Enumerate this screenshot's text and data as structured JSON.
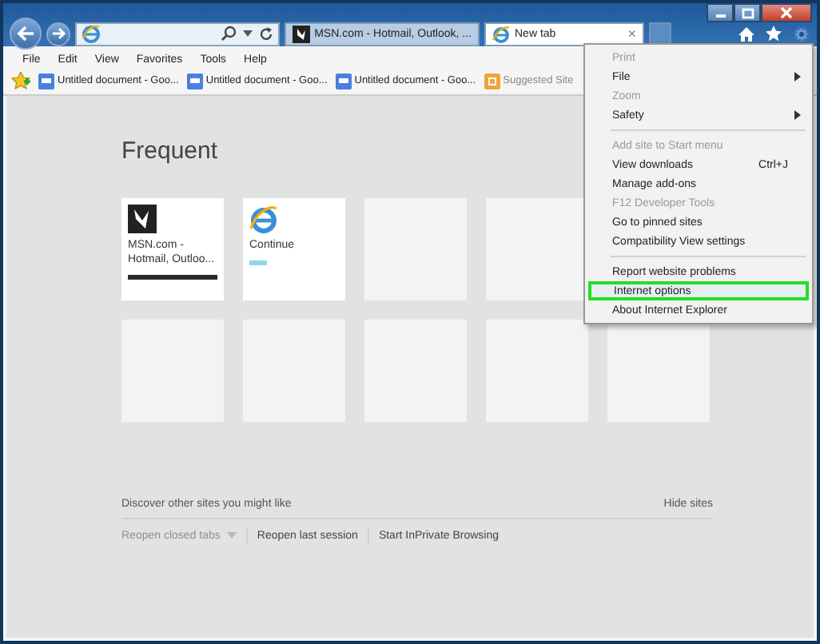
{
  "tabs": [
    {
      "label": "MSN.com - Hotmail, Outlook, ...",
      "kind": "msn",
      "selected": false
    },
    {
      "label": "New tab",
      "kind": "ie",
      "selected": true,
      "close": "×"
    }
  ],
  "menu_bar": [
    "File",
    "Edit",
    "View",
    "Favorites",
    "Tools",
    "Help"
  ],
  "favorites_bar": [
    {
      "label": "Untitled document - Goo...",
      "kind": "doc"
    },
    {
      "label": "Untitled document - Goo...",
      "kind": "doc"
    },
    {
      "label": "Untitled document - Goo...",
      "kind": "doc"
    },
    {
      "label": "Suggested Site",
      "kind": "suggested"
    }
  ],
  "frequent": {
    "title": "Frequent",
    "tile_rows": [
      [
        {
          "kind": "msn",
          "label": "MSN.com - Hotmail, Outloo..."
        },
        {
          "kind": "ie",
          "label": "Continue"
        },
        {
          "kind": "empty"
        },
        {
          "kind": "empty"
        }
      ],
      [
        {
          "kind": "empty"
        },
        {
          "kind": "empty"
        },
        {
          "kind": "empty"
        },
        {
          "kind": "empty"
        },
        {
          "kind": "empty"
        }
      ]
    ]
  },
  "discover": "Discover other sites you might like",
  "hide_sites": "Hide sites",
  "links": [
    {
      "label": "Reopen closed tabs",
      "disabled": true,
      "dropdown": true
    },
    {
      "label": "Reopen last session",
      "disabled": false,
      "dropdown": false
    },
    {
      "label": "Start InPrivate Browsing",
      "disabled": false,
      "dropdown": false
    }
  ],
  "tools_menu": {
    "items": [
      {
        "label": "Print",
        "disabled": true,
        "submenu": false,
        "selected": false
      },
      {
        "label": "File",
        "disabled": false,
        "submenu": true,
        "selected": false
      },
      {
        "label": "Zoom",
        "disabled": true,
        "submenu": false,
        "selected": false
      },
      {
        "label": "Safety",
        "disabled": false,
        "submenu": true,
        "selected": false
      },
      {
        "kind": "separator"
      },
      {
        "label": "Add site to Start menu",
        "disabled": true,
        "submenu": false,
        "selected": false
      },
      {
        "label": "View downloads",
        "shortcut": "Ctrl+J",
        "disabled": false,
        "submenu": false,
        "selected": false
      },
      {
        "label": "Manage add-ons",
        "disabled": false,
        "submenu": false,
        "selected": false
      },
      {
        "label": "F12 Developer Tools",
        "disabled": true,
        "submenu": false,
        "selected": false
      },
      {
        "label": "Go to pinned sites",
        "disabled": false,
        "submenu": false,
        "selected": false
      },
      {
        "label": "Compatibility View settings",
        "disabled": false,
        "submenu": false,
        "selected": false
      },
      {
        "kind": "separator"
      },
      {
        "label": "Report website problems",
        "disabled": false,
        "submenu": false,
        "selected": false
      },
      {
        "label": "Internet options",
        "disabled": false,
        "submenu": false,
        "selected": true
      },
      {
        "label": "About Internet Explorer",
        "disabled": false,
        "submenu": false,
        "selected": false
      }
    ]
  }
}
